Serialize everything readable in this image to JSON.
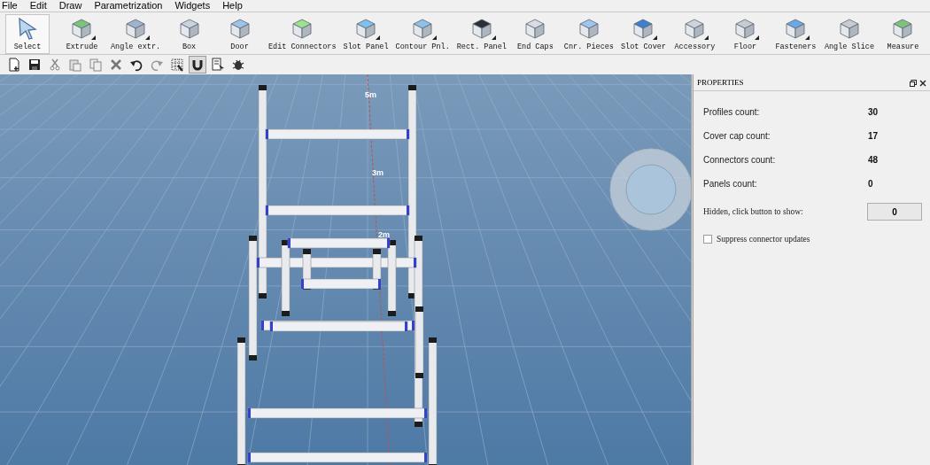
{
  "menu": [
    "File",
    "Edit",
    "Draw",
    "Parametrization",
    "Widgets",
    "Help"
  ],
  "tools": [
    {
      "label": "Select",
      "selected": true,
      "has_menu": false
    },
    {
      "label": "Extrude",
      "selected": false,
      "has_menu": true
    },
    {
      "label": "Angle extr.",
      "selected": false,
      "has_menu": true
    },
    {
      "label": "Box",
      "selected": false,
      "has_menu": false
    },
    {
      "label": "Door",
      "selected": false,
      "has_menu": false
    },
    {
      "label": "Edit Connectors",
      "selected": false,
      "has_menu": false
    },
    {
      "label": "Slot Panel",
      "selected": false,
      "has_menu": true
    },
    {
      "label": "Contour Pnl.",
      "selected": false,
      "has_menu": true
    },
    {
      "label": "Rect. Panel",
      "selected": false,
      "has_menu": true
    },
    {
      "label": "End Caps",
      "selected": false,
      "has_menu": false
    },
    {
      "label": "Cnr. Pieces",
      "selected": false,
      "has_menu": false
    },
    {
      "label": "Slot Cover",
      "selected": false,
      "has_menu": true
    },
    {
      "label": "Accessory",
      "selected": false,
      "has_menu": true
    },
    {
      "label": "Floor",
      "selected": false,
      "has_menu": true
    },
    {
      "label": "Fasteners",
      "selected": false,
      "has_menu": true
    },
    {
      "label": "Angle Slice",
      "selected": false,
      "has_menu": false
    },
    {
      "label": "Measure",
      "selected": false,
      "has_menu": false
    }
  ],
  "quick_tools": [
    {
      "kind": "new",
      "selected": false
    },
    {
      "kind": "save",
      "selected": false
    },
    {
      "kind": "cut",
      "selected": false
    },
    {
      "kind": "paste",
      "selected": false
    },
    {
      "kind": "copy",
      "selected": false
    },
    {
      "kind": "delete",
      "selected": false
    },
    {
      "kind": "undo",
      "selected": false
    },
    {
      "kind": "redo",
      "selected": false
    },
    {
      "kind": "grid",
      "selected": false
    },
    {
      "kind": "magnet",
      "selected": true
    },
    {
      "kind": "pick",
      "selected": false
    },
    {
      "kind": "bug",
      "selected": false
    }
  ],
  "viewport": {
    "distance_labels": [
      "5m",
      "3m",
      "2m"
    ]
  },
  "properties": {
    "title": "PROPERTIES",
    "rows": [
      {
        "label": "Profiles count:",
        "value": "30"
      },
      {
        "label": "Cover cap count:",
        "value": "17"
      },
      {
        "label": "Connectors count:",
        "value": "48"
      },
      {
        "label": "Panels count:",
        "value": "0"
      }
    ],
    "hidden": {
      "label": "Hidden, click button to show:",
      "button": "0"
    },
    "suppress": {
      "label": "Suppress connector updates",
      "checked": false
    }
  }
}
